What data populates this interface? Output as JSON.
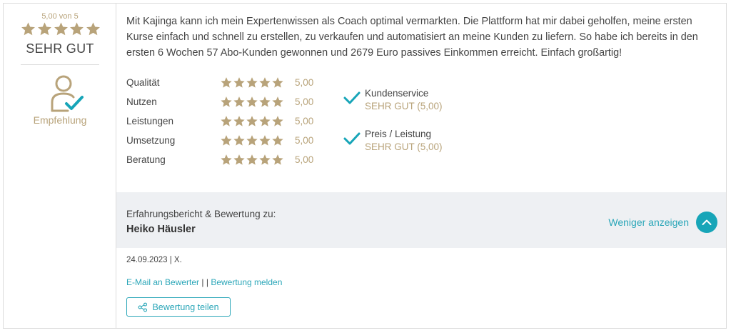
{
  "colors": {
    "gold": "#b8a37a",
    "teal": "#17a5b8",
    "text": "#444444",
    "band_bg": "#eef0f3"
  },
  "summary": {
    "score_text": "5,00 von 5",
    "stars": 5,
    "verdict": "SEHR GUT",
    "recommendation_icon": "user-check-icon",
    "recommendation_label": "Empfehlung"
  },
  "review": {
    "text": "Mit Kajinga kann ich mein Expertenwissen als Coach optimal vermarkten. Die Plattform hat mir dabei geholfen, meine ersten Kurse einfach und schnell zu erstellen, zu verkaufen und automatisiert an meine Kunden zu liefern. So habe ich bereits in den ersten 6 Wochen 57 Abo-Kunden gewonnen und 2679 Euro passives Einkommen erreicht. Einfach großartig!"
  },
  "criteria": [
    {
      "label": "Qualität",
      "stars": 5,
      "value": "5,00"
    },
    {
      "label": "Nutzen",
      "stars": 5,
      "value": "5,00"
    },
    {
      "label": "Leistungen",
      "stars": 5,
      "value": "5,00"
    },
    {
      "label": "Umsetzung",
      "stars": 5,
      "value": "5,00"
    },
    {
      "label": "Beratung",
      "stars": 5,
      "value": "5,00"
    }
  ],
  "positives": [
    {
      "icon": "check-icon",
      "label": "Kundenservice",
      "value": "SEHR GUT (5,00)"
    },
    {
      "icon": "check-icon",
      "label": "Preis / Leistung",
      "value": "SEHR GUT (5,00)"
    }
  ],
  "subject": {
    "label": "Erfahrungsbericht & Bewertung zu:",
    "name": "Heiko Häusler",
    "less_link": "Weniger anzeigen",
    "less_icon": "chevron-up-icon"
  },
  "meta": {
    "date_author": "24.09.2023 | X."
  },
  "actions": {
    "email": "E-Mail an Bewerter",
    "separator": "| |",
    "report": "Bewertung melden",
    "share_label": "Bewertung teilen",
    "share_icon": "share-icon"
  }
}
